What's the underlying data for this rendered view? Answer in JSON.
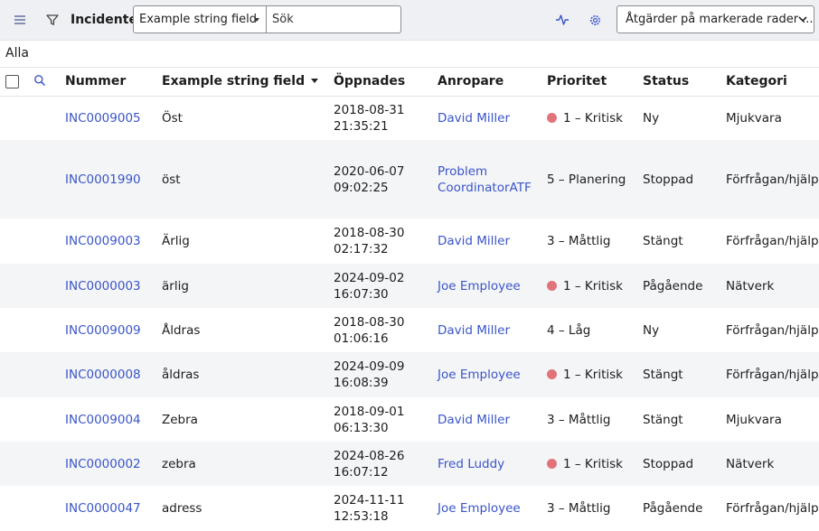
{
  "header": {
    "title": "Incidenter",
    "field_select_value": "Example string field",
    "search_placeholder": "Sök",
    "actions_select_value": "Åtgärder på markerade rader ...",
    "icons": [
      "menu-icon",
      "filter-icon",
      "pulse-icon",
      "gear-icon"
    ]
  },
  "breadcrumb": "Alla",
  "table": {
    "columns": [
      "Nummer",
      "Example string field",
      "Öppnades",
      "Anropare",
      "Prioritet",
      "Status",
      "Kategori"
    ],
    "sorted_column": "Example string field",
    "sort_direction": "descending",
    "rows": [
      {
        "number": "INC0009005",
        "field": "Öst",
        "date": "2018-08-31",
        "time": "21:35:21",
        "caller1": "David Miller",
        "caller2": "",
        "priority": "1 – Kritisk",
        "critical": true,
        "status": "Ny",
        "category": "Mjukvara"
      },
      {
        "number": "INC0001990",
        "field": "öst",
        "date": "2020-06-07",
        "time": "09:02:25",
        "caller1": "Problem",
        "caller2": "CoordinatorATF",
        "priority": "5 – Planering",
        "critical": false,
        "status": "Stoppad",
        "category": "Förfrågan/hjälp"
      },
      {
        "number": "INC0009003",
        "field": "Ärlig",
        "date": "2018-08-30",
        "time": "02:17:32",
        "caller1": "David Miller",
        "caller2": "",
        "priority": "3 – Måttlig",
        "critical": false,
        "status": "Stängt",
        "category": "Förfrågan/hjälp"
      },
      {
        "number": "INC0000003",
        "field": "ärlig",
        "date": "2024-09-02",
        "time": "16:07:30",
        "caller1": "Joe Employee",
        "caller2": "",
        "priority": "1 – Kritisk",
        "critical": true,
        "status": "Pågående",
        "category": "Nätverk"
      },
      {
        "number": "INC0009009",
        "field": "Åldras",
        "date": "2018-08-30",
        "time": "01:06:16",
        "caller1": "David Miller",
        "caller2": "",
        "priority": "4 – Låg",
        "critical": false,
        "status": "Ny",
        "category": "Förfrågan/hjälp"
      },
      {
        "number": "INC0000008",
        "field": "åldras",
        "date": "2024-09-09",
        "time": "16:08:39",
        "caller1": "Joe Employee",
        "caller2": "",
        "priority": "1 – Kritisk",
        "critical": true,
        "status": "Stängt",
        "category": "Förfrågan/hjälp"
      },
      {
        "number": "INC0009004",
        "field": "Zebra",
        "date": "2018-09-01",
        "time": "06:13:30",
        "caller1": "David Miller",
        "caller2": "",
        "priority": "3 – Måttlig",
        "critical": false,
        "status": "Stängt",
        "category": "Mjukvara"
      },
      {
        "number": "INC0000002",
        "field": "zebra",
        "date": "2024-08-26",
        "time": "16:07:12",
        "caller1": "Fred Luddy",
        "caller2": "",
        "priority": "1 – Kritisk",
        "critical": true,
        "status": "Stoppad",
        "category": "Nätverk"
      },
      {
        "number": "INC0000047",
        "field": "adress",
        "date": "2024-11-11",
        "time": "12:53:18",
        "caller1": "Joe Employee",
        "caller2": "",
        "priority": "3 – Måttlig",
        "critical": false,
        "status": "Pågående",
        "category": "Förfrågan/hjälp"
      }
    ]
  },
  "colors": {
    "link": "#3a55c8",
    "critical_dot": "#e0747a",
    "header_bg": "#eef0f3",
    "row_alt": "#f4f5f7"
  }
}
